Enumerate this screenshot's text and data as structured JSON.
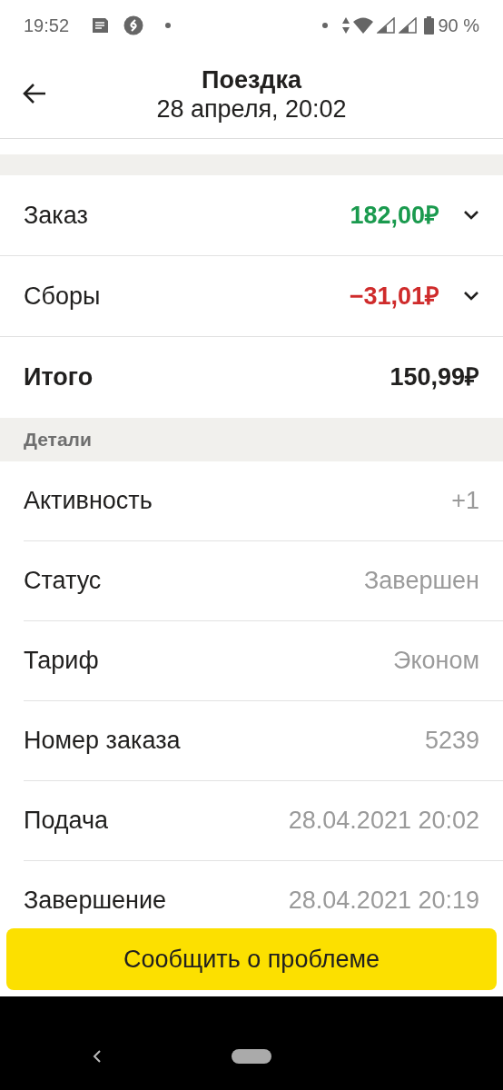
{
  "status_bar": {
    "time": "19:52",
    "battery": "90 %"
  },
  "header": {
    "title": "Поездка",
    "subtitle": "28 апреля, 20:02"
  },
  "summary": [
    {
      "kind": "income",
      "label": "Заказ",
      "amount": "182,00₽",
      "expanded": false
    },
    {
      "kind": "fee",
      "label": "Сборы",
      "amount": "−31,01₽",
      "expanded": false
    },
    {
      "kind": "total",
      "label": "Итого",
      "amount": "150,99₽"
    }
  ],
  "details": {
    "title": "Детали",
    "rows": [
      {
        "label": "Активность",
        "value": "+1"
      },
      {
        "label": "Статус",
        "value": "Завершен"
      },
      {
        "label": "Тариф",
        "value": "Эконом"
      },
      {
        "label": "Номер заказа",
        "value": "5239"
      },
      {
        "label": "Подача",
        "value": "28.04.2021 20:02"
      },
      {
        "label": "Завершение",
        "value": "28.04.2021 20:19"
      }
    ]
  },
  "report_button": "Сообщить о проблеме"
}
